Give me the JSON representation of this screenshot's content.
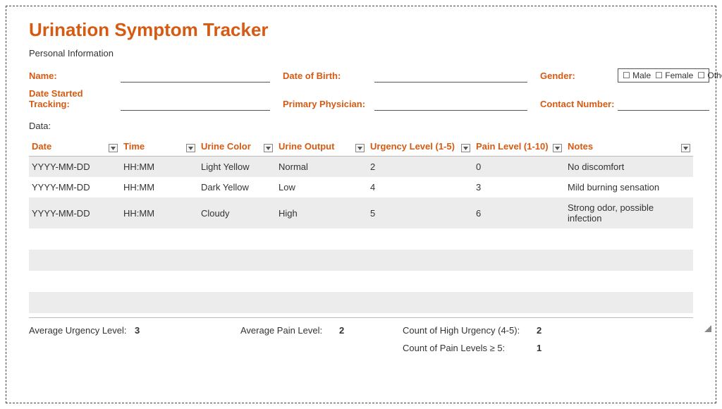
{
  "title": "Urination Symptom Tracker",
  "section_personal": "Personal Information",
  "info": {
    "name_label": "Name:",
    "dob_label": "Date of Birth:",
    "gender_label": "Gender:",
    "gender_male": "Male",
    "gender_female": "Female",
    "gender_other": "Other",
    "date_started_label": "Date Started Tracking:",
    "physician_label": "Primary Physician:",
    "contact_label": "Contact Number:"
  },
  "data_label": "Data:",
  "columns": {
    "date": "Date",
    "time": "Time",
    "color": "Urine Color",
    "output": "Urine Output",
    "urgency": "Urgency Level (1-5)",
    "pain": "Pain Level (1-10)",
    "notes": "Notes"
  },
  "rows": [
    {
      "date": "YYYY-MM-DD",
      "time": "HH:MM",
      "color": "Light Yellow",
      "output": "Normal",
      "urgency": "2",
      "pain": "0",
      "notes": "No discomfort"
    },
    {
      "date": "YYYY-MM-DD",
      "time": "HH:MM",
      "color": "Dark Yellow",
      "output": "Low",
      "urgency": "4",
      "pain": "3",
      "notes": "Mild burning sensation"
    },
    {
      "date": "YYYY-MM-DD",
      "time": "HH:MM",
      "color": "Cloudy",
      "output": "High",
      "urgency": "5",
      "pain": "6",
      "notes": "Strong odor, possible infection"
    }
  ],
  "summary": {
    "avg_urgency_label": "Average Urgency Level:",
    "avg_urgency": "3",
    "avg_pain_label": "Average Pain Level:",
    "avg_pain": "2",
    "high_urgency_label": "Count of High Urgency (4-5):",
    "high_urgency": "2",
    "high_pain_label": "Count of Pain Levels ≥ 5:",
    "high_pain": "1"
  }
}
